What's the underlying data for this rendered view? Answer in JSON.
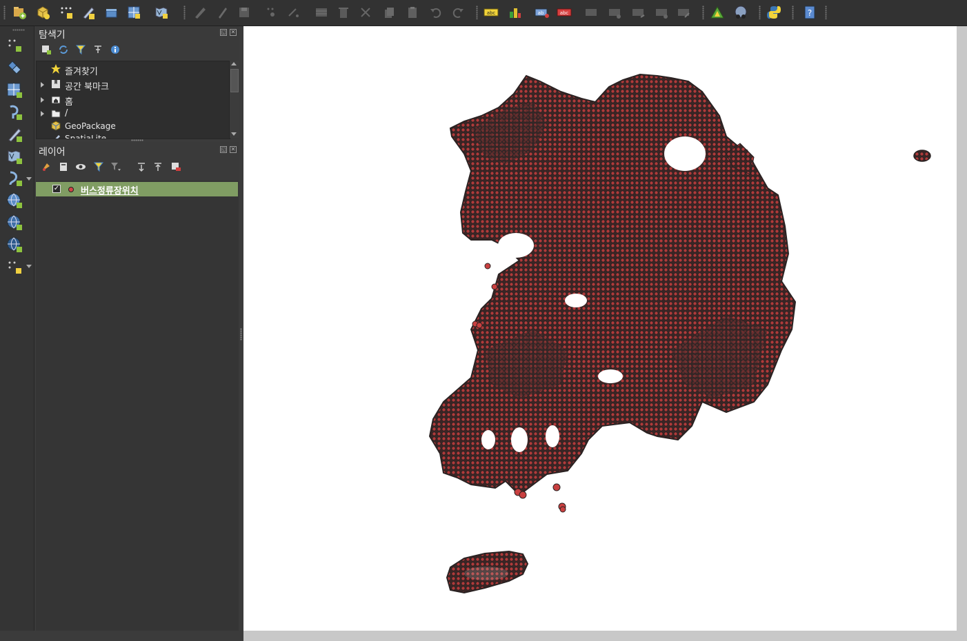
{
  "toolbar": {
    "icons": [
      "open-data-source-manager-icon",
      "new-geopackage-layer-icon",
      "new-temporary-scratch-layer-icon",
      "new-shapefile-layer-icon",
      "add-layer-icon",
      "add-virtual-layer-icon",
      "add-wms-layer-icon",
      "current-edits-icon",
      "toggle-editing-icon",
      "save-layer-edits-icon",
      "add-feature-icon",
      "vertex-tool-icon",
      "modify-attributes-icon",
      "delete-selected-icon",
      "cut-features-icon",
      "copy-features-icon",
      "paste-features-icon",
      "undo-icon",
      "redo-icon",
      "label-tool-icon",
      "diagram-tool-icon",
      "highlight-pinned-labels-icon",
      "pin-labels-icon",
      "show-hide-labels-icon",
      "move-label-icon",
      "rotate-label-icon",
      "change-label-icon",
      "label-properties-icon",
      "processing-toolbox-icon",
      "plugin-icon",
      "python-console-icon",
      "help-icon"
    ]
  },
  "left_toolbar": {
    "icons": [
      "add-delimited-text-layer-icon",
      "add-vector-layer-icon",
      "add-raster-layer-icon",
      "add-postgis-layer-icon",
      "add-spatialite-layer-icon",
      "add-virtual-layer-icon",
      "add-mssql-layer-icon",
      "add-wms-wmts-layer-icon",
      "add-wcs-layer-icon",
      "add-wfs-layer-icon",
      "new-temporary-layer-icon"
    ]
  },
  "browser_panel": {
    "title": "탐색기",
    "tools": [
      "add-selected-layers-icon",
      "refresh-icon",
      "filter-icon",
      "collapse-all-icon",
      "properties-icon"
    ],
    "items": [
      {
        "label": "즐겨찾기",
        "icon": "star-icon",
        "expandable": false
      },
      {
        "label": "공간 북마크",
        "icon": "bookmark-icon",
        "expandable": true
      },
      {
        "label": "홈",
        "icon": "home-folder-icon",
        "expandable": true
      },
      {
        "label": "/",
        "icon": "folder-icon",
        "expandable": true
      },
      {
        "label": "GeoPackage",
        "icon": "geopackage-icon",
        "expandable": false
      },
      {
        "label": "SpatiaLite",
        "icon": "spatialite-icon",
        "expandable": false
      }
    ]
  },
  "layers_panel": {
    "title": "레이어",
    "tools": [
      "open-layer-styling-icon",
      "add-group-icon",
      "manage-map-themes-icon",
      "filter-legend-icon",
      "filter-by-expression-icon",
      "expand-all-icon",
      "collapse-all-icon",
      "remove-layer-icon"
    ],
    "layers": [
      {
        "name": "버스정류장위치",
        "checked": true,
        "symbol_color": "#d04545"
      }
    ]
  },
  "map": {
    "background": "#ffffff",
    "point_fill": "#d04545",
    "point_stroke": "#2a2222"
  },
  "colors": {
    "layer_highlight": "#809d63",
    "panel_bg": "#3a3a3a"
  }
}
